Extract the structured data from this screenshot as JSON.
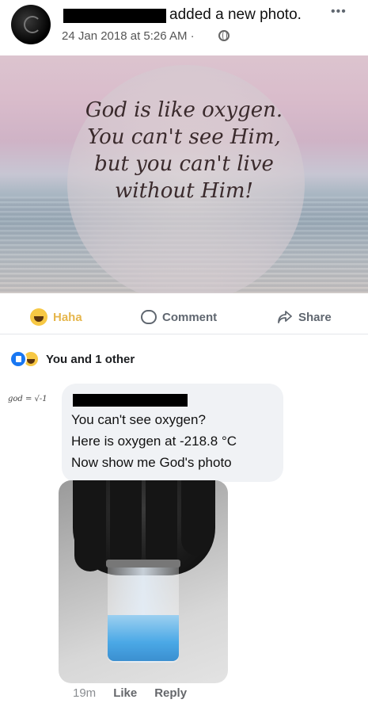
{
  "post": {
    "action_text": "added a new photo.",
    "timestamp": "24 Jan 2018 at 5:26 AM ·",
    "more_icon": "ellipsis-icon",
    "privacy_icon": "globe-icon"
  },
  "photo": {
    "quote_lines": [
      "God is like oxygen.",
      "You can't see Him,",
      "but you can't live",
      "without Him!"
    ]
  },
  "actions": {
    "haha": "Haha",
    "comment": "Comment",
    "share": "Share"
  },
  "reactions": {
    "text": "You and 1 other"
  },
  "comment": {
    "avatar_text": "god = √-1",
    "lines": [
      "You can't see oxygen?",
      "Here is oxygen at -218.8 °C",
      "Now show me God's photo"
    ],
    "time": "19m",
    "like": "Like",
    "reply": "Reply"
  }
}
